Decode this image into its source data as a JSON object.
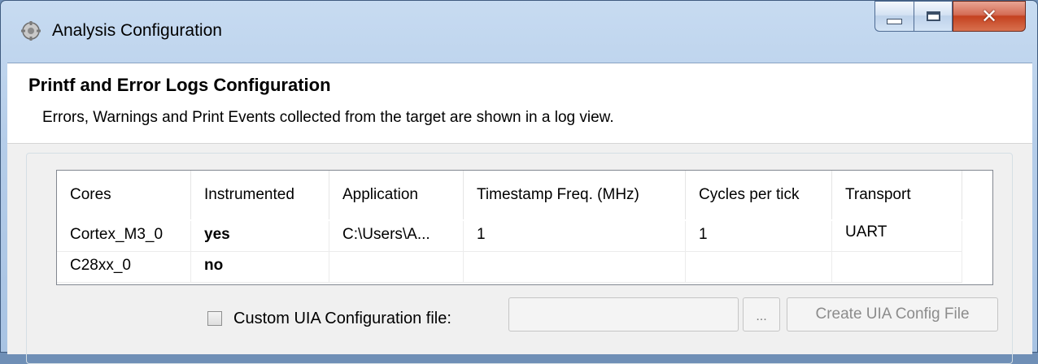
{
  "window": {
    "title": "Analysis Configuration",
    "icon": "gear-app-icon",
    "controls": [
      "minimize",
      "maximize",
      "close"
    ]
  },
  "header": {
    "title": "Printf and Error Logs Configuration",
    "description": "Errors, Warnings and Print Events collected from the target are shown in a log view."
  },
  "table": {
    "columns": [
      "Cores",
      "Instrumented",
      "Application",
      "Timestamp Freq. (MHz)",
      "Cycles per tick",
      "Transport"
    ],
    "rows": [
      [
        "Cortex_M3_0",
        "yes",
        "C:\\Users\\A...",
        "1",
        "1",
        "UART"
      ],
      [
        "C28xx_0",
        "no",
        "",
        "",
        "",
        ""
      ]
    ]
  },
  "uia": {
    "checkbox_label": "Custom UIA Configuration file:",
    "checked": false,
    "input_value": "",
    "browse_label": "...",
    "create_label": "Create UIA Config File"
  }
}
